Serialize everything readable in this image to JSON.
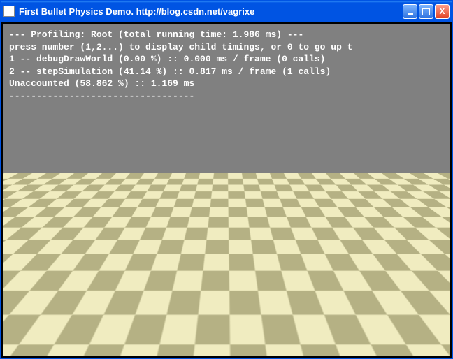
{
  "window": {
    "title": "First Bullet Physics Demo. http://blog.csdn.net/vagrixe"
  },
  "buttons": {
    "close": "X"
  },
  "profiling": {
    "line1": "--- Profiling: Root (total running time: 1.986 ms) ---",
    "line2": "press number (1,2...) to display child timings, or 0 to go up t",
    "line3": "1 -- debugDrawWorld (0.00 %) :: 0.000 ms / frame (0 calls)",
    "line4": "2 -- stepSimulation (41.14 %) :: 0.817 ms / frame (1 calls)",
    "line5": "Unaccounted (58.862 %) :: 1.169 ms",
    "line6": "----------------------------------"
  }
}
